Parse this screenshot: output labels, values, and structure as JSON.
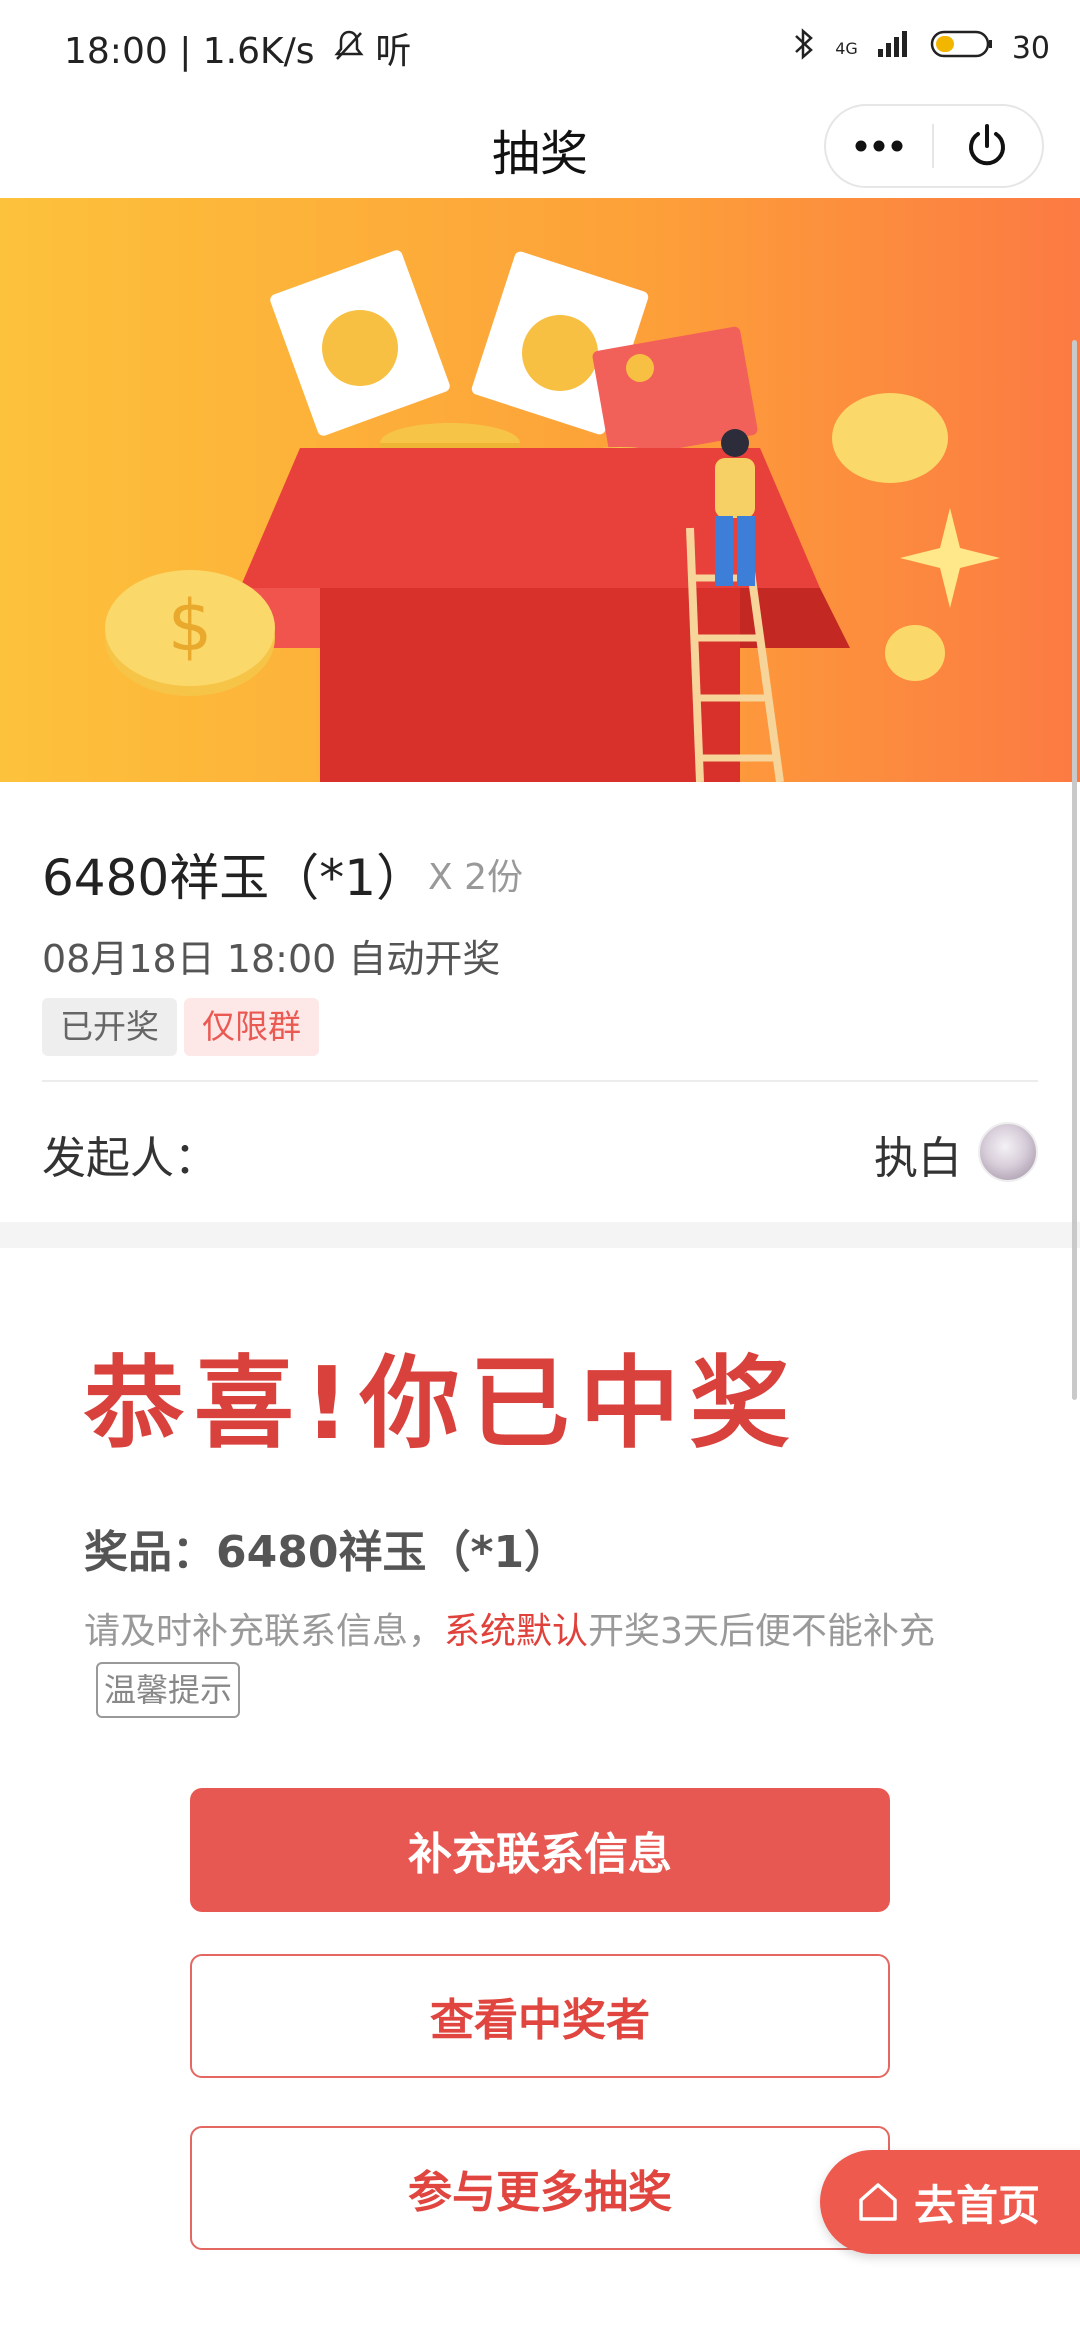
{
  "status_bar": {
    "time_speed": "18:00 | 1.6K/s",
    "listen": "听",
    "network": "4G",
    "battery": "30"
  },
  "nav": {
    "title": "抽奖"
  },
  "lottery": {
    "prize_title": "6480祥玉（*1）",
    "quantity": "X 2份",
    "open_time": "08月18日 18:00 自动开奖",
    "tag_done": "已开奖",
    "tag_group": "仅限群",
    "sponsor_label": "发起人：",
    "sponsor_name": "执白"
  },
  "result": {
    "headline": "恭喜!你已中奖",
    "prize_line": "奖品：6480祥玉（*1）",
    "tip_prefix": "请及时补充联系信息，",
    "tip_highlight": "系统默认",
    "tip_suffix": "开奖3天后便不能补充",
    "tip_badge": "温馨提示"
  },
  "buttons": {
    "fill_contact": "补充联系信息",
    "view_winners": "查看中奖者",
    "more_lottery": "参与更多抽奖",
    "go_home": "去首页"
  },
  "colors": {
    "accent_red": "#e85853",
    "banner_orange": "#fbb03b"
  }
}
